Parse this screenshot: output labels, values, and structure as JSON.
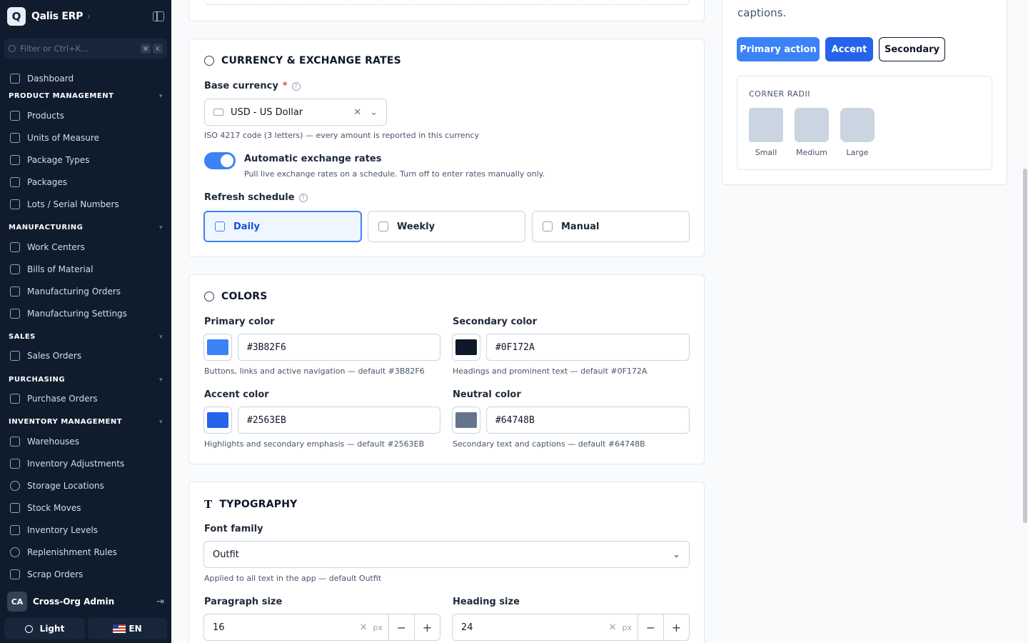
{
  "app": {
    "logo_letter": "Q",
    "title": "Qalis ERP"
  },
  "sidebar": {
    "search_placeholder": "Filter or Ctrl+K...",
    "kbd1": "⌘",
    "kbd2": "K",
    "dashboard": "Dashboard",
    "sections": [
      {
        "title": "PRODUCT MANAGEMENT",
        "items": [
          "Products",
          "Units of Measure",
          "Package Types",
          "Packages",
          "Lots / Serial Numbers"
        ]
      },
      {
        "title": "MANUFACTURING",
        "items": [
          "Work Centers",
          "Bills of Material",
          "Manufacturing Orders",
          "Manufacturing Settings"
        ]
      },
      {
        "title": "SALES",
        "items": [
          "Sales Orders"
        ]
      },
      {
        "title": "PURCHASING",
        "items": [
          "Purchase Orders"
        ]
      },
      {
        "title": "INVENTORY MANAGEMENT",
        "items": [
          "Warehouses",
          "Inventory Adjustments",
          "Storage Locations",
          "Stock Moves",
          "Inventory Levels",
          "Replenishment Rules",
          "Scrap Orders"
        ]
      }
    ],
    "user": {
      "initials": "CA",
      "name": "Cross-Org Admin"
    },
    "theme_label": "Light",
    "lang_label": "EN"
  },
  "currency": {
    "title": "CURRENCY & EXCHANGE RATES",
    "base_label": "Base currency",
    "required": "*",
    "base_value": "USD - US Dollar",
    "base_hint": "ISO 4217 code (3 letters) — every amount is reported in this currency",
    "auto_label": "Automatic exchange rates",
    "auto_hint": "Pull live exchange rates on a schedule. Turn off to enter rates manually only.",
    "refresh_label": "Refresh schedule",
    "options": [
      "Daily",
      "Weekly",
      "Manual"
    ]
  },
  "colors": {
    "title": "COLORS",
    "primary": {
      "label": "Primary color",
      "value": "#3B82F6",
      "hint": "Buttons, links and active navigation — default #3B82F6"
    },
    "secondary": {
      "label": "Secondary color",
      "value": "#0F172A",
      "hint": "Headings and prominent text — default #0F172A"
    },
    "accent": {
      "label": "Accent color",
      "value": "#2563EB",
      "hint": "Highlights and secondary emphasis — default #2563EB"
    },
    "neutral": {
      "label": "Neutral color",
      "value": "#64748B",
      "hint": "Secondary text and captions — default #64748B"
    }
  },
  "typography": {
    "title": "TYPOGRAPHY",
    "font_label": "Font family",
    "font_value": "Outfit",
    "font_hint": "Applied to all text in the app — default Outfit",
    "paragraph_label": "Paragraph size",
    "paragraph_value": "16",
    "heading_label": "Heading size",
    "heading_value": "24",
    "unit": "px"
  },
  "preview": {
    "text": "captions.",
    "primary_btn": "Primary action",
    "accent_btn": "Accent",
    "secondary_btn": "Secondary",
    "radii_title": "CORNER RADII",
    "radii": [
      "Small",
      "Medium",
      "Large"
    ]
  }
}
